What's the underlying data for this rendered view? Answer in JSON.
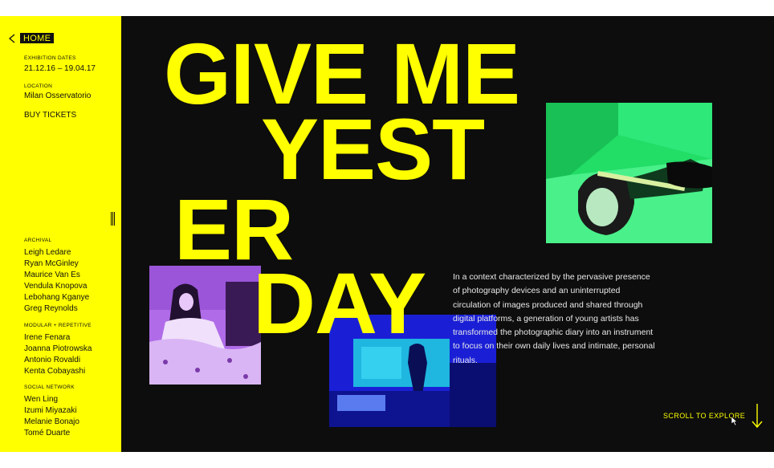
{
  "sidebar": {
    "home_label": "HOME",
    "dates_label": "EXHIBITION DATES",
    "dates_value": "21.12.16 – 19.04.17",
    "location_label": "LOCATION",
    "location_value": "Milan Osservatorio",
    "buy_tickets": "BUY TICKETS",
    "groups": [
      {
        "label": "ARCHIVAL",
        "items": [
          "Leigh Ledare",
          "Ryan McGinley",
          "Maurice Van Es",
          "Vendula Knopova",
          "Lebohang Kganye",
          "Greg Reynolds"
        ]
      },
      {
        "label": "MODULAR + REPETITIVE",
        "items": [
          "Irene Fenara",
          "Joanna Piotrowska",
          "Antonio Rovaldi",
          "Kenta Cobayashi"
        ]
      },
      {
        "label": "SOCIAL NETWORK",
        "items": [
          "Wen Ling",
          "Izumi Miyazaki",
          "Melanie Bonajo",
          "Tomé Duarte"
        ]
      }
    ]
  },
  "main": {
    "headline": [
      "GIVE ME",
      "YEST",
      "ER",
      "DAY"
    ],
    "body": "In a context characterized by the pervasive presence of photography devices and an uninterrupted circulation of images produced and shared through digital platforms, a generation of young artists has transformed the photographic diary into an instrument to focus on their own daily lives and intimate, personal rituals.",
    "scroll_label": "SCROLL TO EXPLORE"
  },
  "colors": {
    "accent": "#ffff00",
    "background": "#0d0d0d",
    "photo_green": "#22dd66",
    "photo_purple": "#b06be8",
    "photo_blue": "#1a1fd6"
  },
  "icons": [
    "chevron-left-icon",
    "resize-handle-icon",
    "arrow-down-icon",
    "cursor-icon"
  ]
}
